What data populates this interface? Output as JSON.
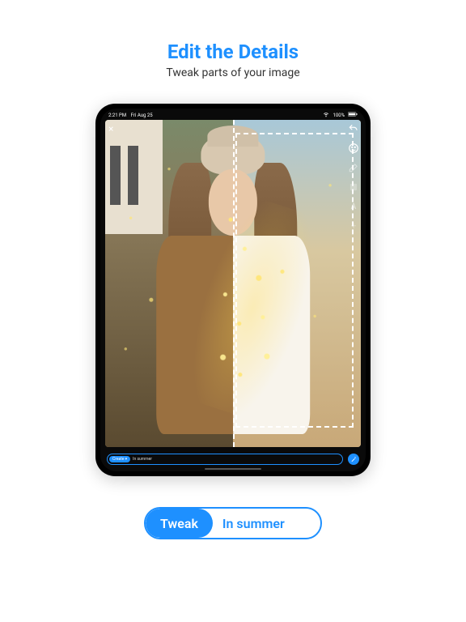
{
  "heading": "Edit the Details",
  "subheading": "Tweak parts of your image",
  "status": {
    "time": "2:21 PM",
    "date": "Fri Aug 25",
    "battery": "100%"
  },
  "tools": {
    "close": "×",
    "undo": "undo",
    "face_retouch": "face",
    "brush": "brush",
    "layers": "layers",
    "text": "A",
    "add": "+"
  },
  "prompt": {
    "mode_label": "Create",
    "mode_chevron": "▾",
    "text": "In summer"
  },
  "big_pill": {
    "chip": "Tweak",
    "text": "In summer"
  }
}
